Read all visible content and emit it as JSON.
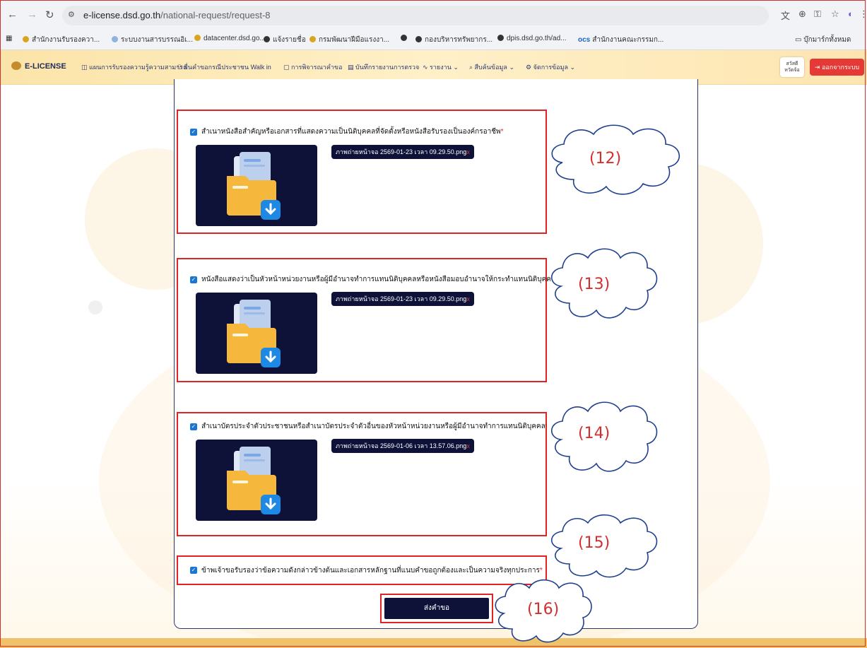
{
  "browser": {
    "url_domain": "e-license.dsd.go.th",
    "url_path": "/national-request/request-8",
    "bookmarks": [
      "สำนักงานรับรองควา...",
      "ระบบงานสารบรรณอิเ...",
      "datacenter.dsd.go...",
      "แจ้งรายชื่อ",
      "กรมพัฒนาฝีมือแรงงา...",
      "กองบริหารทรัพยากร...",
      "dpis.dsd.go.th/ad...",
      "สำนักงานคณะกรรมก..."
    ],
    "all_bookmarks": "บุ๊กมาร์กทั้งหมด"
  },
  "appnav": {
    "logo": "E-LICENSE",
    "menu": [
      "แผนการรับรองความรู้ความสามารถ",
      "ยื่นคำขอกรณีประชาชน Walk in",
      "การพิจารณาคำขอ",
      "บันทึกรายงานการตรวจ",
      "รายงาน",
      "สืบค้นข้อมูล",
      "จัดการข้อมูล"
    ],
    "user_line1": "สวัสดี",
    "user_line2": "หวัดจ้อ",
    "logout": "ออกจากระบบ"
  },
  "sections": [
    {
      "label": "สำเนาหนังสือสำคัญหรือเอกสารที่แสดงความเป็นนิติบุคคลที่จัดตั้งหรือหนังสือรับรองเป็นองค์กรอาชีพ",
      "required": "*",
      "file": "ภาพถ่ายหน้าจอ 2569-01-23 เวลา 09.29.50.png",
      "remove": "x"
    },
    {
      "label": "หนังสือแสดงว่าเป็นหัวหน้าหน่วยงานหรือผู้มีอำนาจทำการแทนนิติบุคคลหรือหนังสือมอบอำนาจให้กระทำแทนนิติบุคคล",
      "required": "*",
      "file": "ภาพถ่ายหน้าจอ 2569-01-23 เวลา 09.29.50.png",
      "remove": "x"
    },
    {
      "label": "สำเนาบัตรประจำตัวประชาชนหรือสำเนาบัตรประจำตัวอื่นของหัวหน้าหน่วยงานหรือผู้มีอำนาจทำการแทนนิติบุคคลที่ทางรัฐออกให้",
      "required": "*",
      "file": "ภาพถ่ายหน้าจอ 2569-01-06 เวลา 13.57.06.png",
      "remove": "x"
    }
  ],
  "certify": {
    "label": "ข้าพเจ้าขอรับรองว่าข้อความดังกล่าวข้างต้นและเอกสารหลักฐานที่แนบคำขอถูกต้องและเป็นความจริงทุกประการ",
    "required": "*"
  },
  "submit_label": "ส่งคำขอ",
  "annotations": [
    "(12)",
    "(13)",
    "(14)",
    "(15)",
    "(16)"
  ],
  "colors": {
    "accent": "#0e1239",
    "highlight": "#e02424",
    "checkbox": "#1976d2",
    "logout": "#e53935"
  }
}
